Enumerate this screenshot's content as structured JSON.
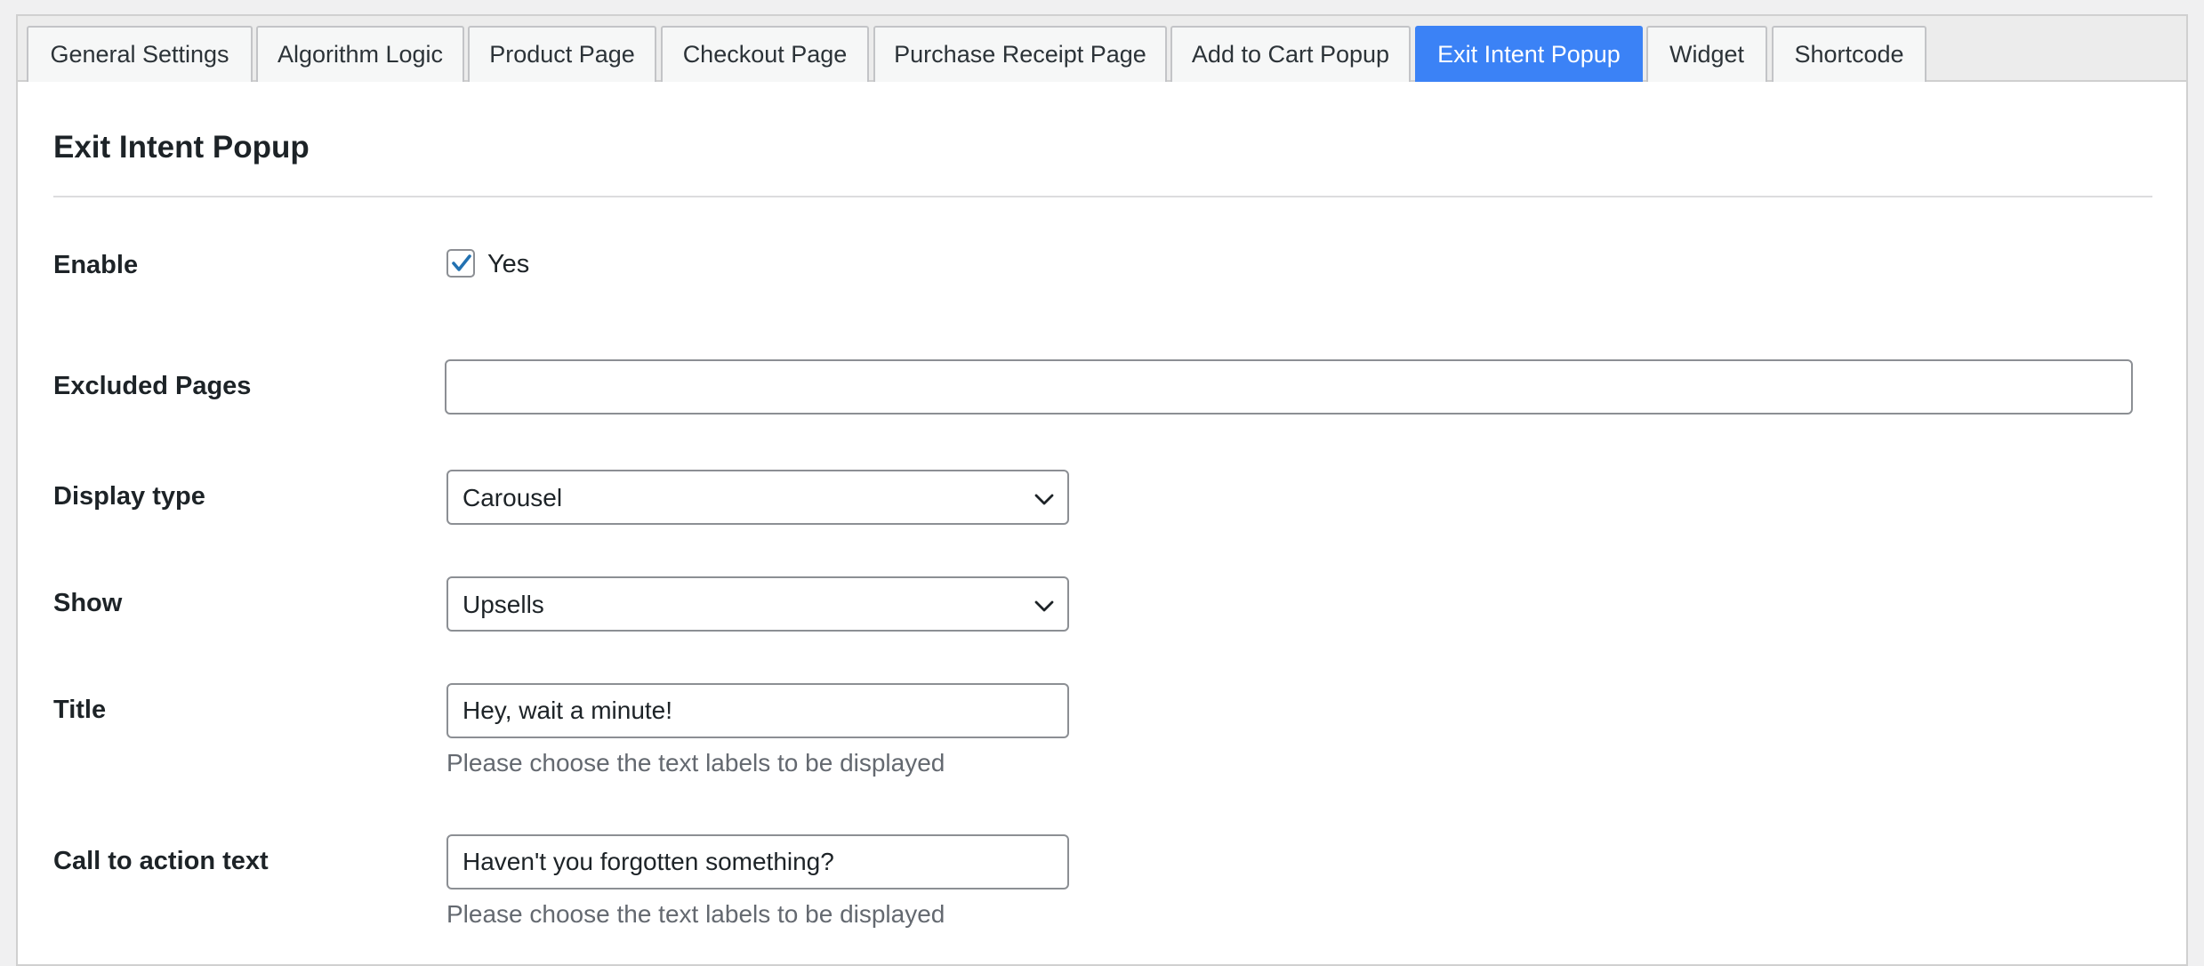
{
  "tabs": [
    {
      "label": "General Settings",
      "active": false
    },
    {
      "label": "Algorithm Logic",
      "active": false
    },
    {
      "label": "Product Page",
      "active": false
    },
    {
      "label": "Checkout Page",
      "active": false
    },
    {
      "label": "Purchase Receipt Page",
      "active": false
    },
    {
      "label": "Add to Cart Popup",
      "active": false
    },
    {
      "label": "Exit Intent Popup",
      "active": true
    },
    {
      "label": "Widget",
      "active": false
    },
    {
      "label": "Shortcode",
      "active": false
    }
  ],
  "section_title": "Exit Intent Popup",
  "fields": {
    "enable": {
      "label": "Enable",
      "checkbox_label": "Yes",
      "checked": true
    },
    "excluded_pages": {
      "label": "Excluded Pages",
      "value": ""
    },
    "display_type": {
      "label": "Display type",
      "value": "Carousel"
    },
    "show": {
      "label": "Show",
      "value": "Upsells"
    },
    "title": {
      "label": "Title",
      "value": "Hey, wait a minute!",
      "help": "Please choose the text labels to be displayed"
    },
    "cta": {
      "label": "Call to action text",
      "value": "Haven't you forgotten something?",
      "help": "Please choose the text labels to be displayed"
    }
  },
  "colors": {
    "accent": "#3b82f6",
    "checkmark": "#2271b1"
  },
  "icons": {
    "checkbox": "checkmark-icon",
    "select": "chevron-down-icon"
  }
}
